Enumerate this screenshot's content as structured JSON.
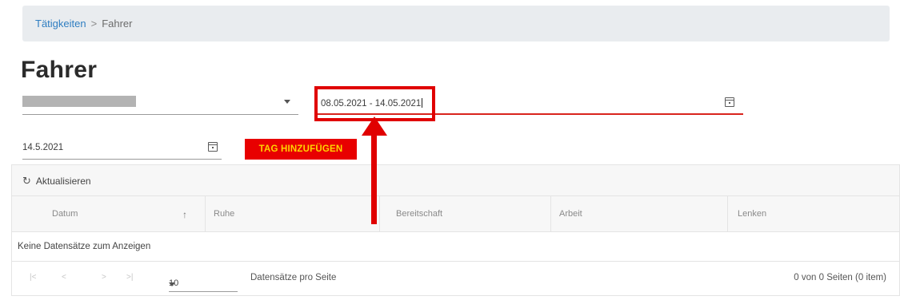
{
  "breadcrumb": {
    "parent": "Tätigkeiten",
    "separator": ">",
    "current": "Fahrer"
  },
  "page": {
    "title": "Fahrer"
  },
  "filters": {
    "driver_select": {
      "value": ""
    },
    "date_range": {
      "value": "08.05.2021 - 14.05.2021"
    },
    "day_date": {
      "value": "14.5.2021"
    },
    "add_day_label": "TAG HINZUFÜGEN"
  },
  "grid": {
    "refresh_label": "Aktualisieren",
    "columns": [
      "Datum",
      "Ruhe",
      "Bereitschaft",
      "Arbeit",
      "Lenken"
    ],
    "sort_indicator": "↑",
    "empty_message": "Keine Datensätze zum Anzeigen",
    "pager": {
      "page_size": "10",
      "per_page_label": "Datensätze pro Seite",
      "page_info": "0 von 0 Seiten (0 item)"
    }
  },
  "icons": {
    "calendar": "calendar-icon",
    "refresh": "refresh-icon",
    "sort": "sort-ascending-icon"
  },
  "colors": {
    "accent_red": "#e00000",
    "button_text": "#ffd400",
    "link_blue": "#2f7ec1",
    "breadcrumb_bg": "#e9ecef"
  }
}
